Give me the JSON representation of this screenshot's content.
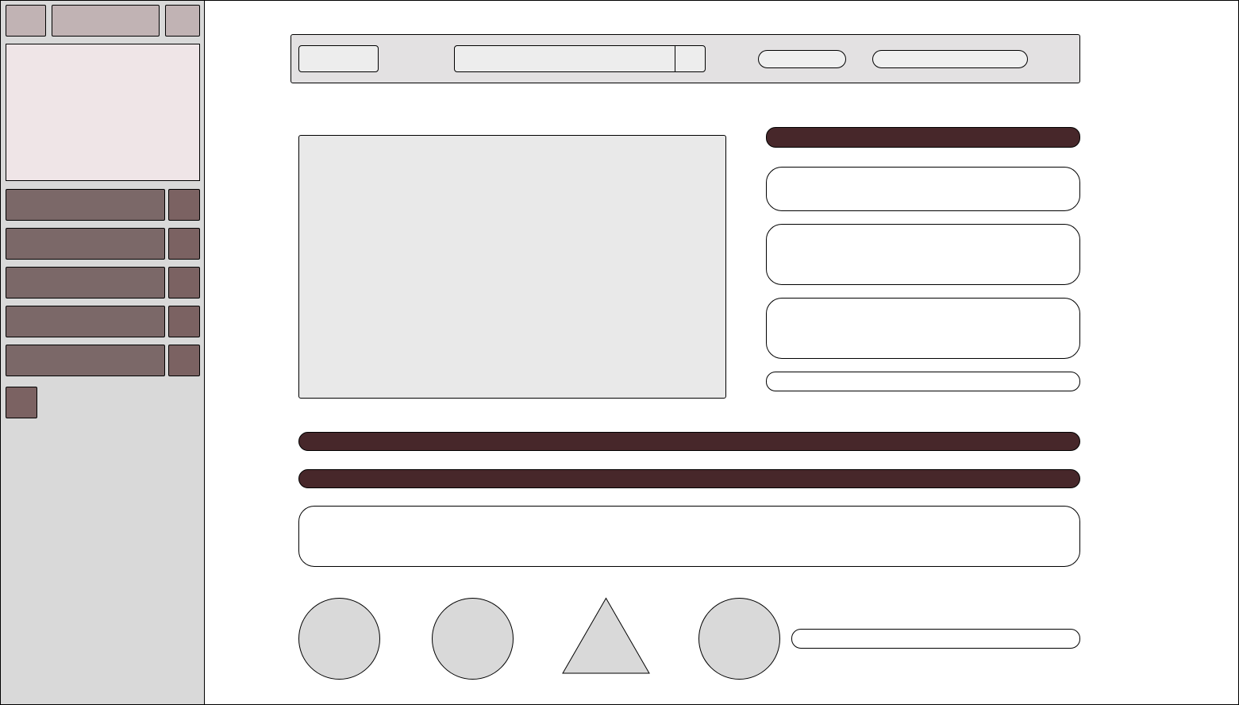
{
  "colors": {
    "sidebar_bg": "#d9d9d9",
    "sidebar_top": "#c1b3b4",
    "sidebar_panel": "#efe5e7",
    "sidebar_row": "#7b6868",
    "toolbar_bg": "#e3e1e2",
    "preview_bg": "#e9e9e9",
    "dark_accent": "#47272a",
    "shape_fill": "#d9d9d9"
  },
  "sidebar": {
    "top_buttons": [
      "",
      "",
      ""
    ],
    "rows": [
      "",
      "",
      "",
      "",
      ""
    ],
    "add_button": ""
  },
  "toolbar": {
    "left_button": "",
    "search_placeholder": "",
    "pill_short": "",
    "pill_long": ""
  },
  "right_panel": {
    "header": "",
    "cards": [
      "",
      "",
      ""
    ],
    "footer": ""
  },
  "bars": [
    "",
    ""
  ],
  "wide_card": "",
  "shapes": [
    "circle",
    "circle",
    "triangle",
    "circle"
  ],
  "bottom_input": ""
}
